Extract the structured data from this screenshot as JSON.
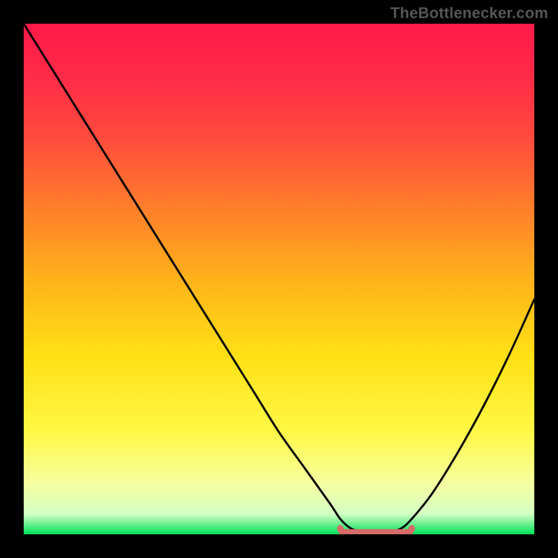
{
  "attribution": "TheBottlenecker.com",
  "chart_data": {
    "type": "line",
    "title": "",
    "xlabel": "",
    "ylabel": "",
    "xlim": [
      0,
      100
    ],
    "ylim": [
      0,
      100
    ],
    "x": [
      0,
      5,
      10,
      15,
      20,
      25,
      30,
      35,
      40,
      45,
      50,
      55,
      60,
      62,
      64,
      66,
      68,
      70,
      72,
      74,
      76,
      80,
      85,
      90,
      95,
      100
    ],
    "values": [
      100,
      92,
      84,
      76,
      68,
      60,
      52,
      44,
      36,
      28,
      20,
      13,
      6,
      3,
      1.2,
      0.5,
      0.2,
      0.2,
      0.5,
      1.2,
      3,
      8,
      16,
      25,
      35,
      46
    ],
    "trough": {
      "x_start": 62,
      "x_end": 76,
      "y": 0.4
    },
    "gradient_stops": [
      {
        "offset": 0.0,
        "color": "#ff1a4a"
      },
      {
        "offset": 0.1,
        "color": "#ff2a48"
      },
      {
        "offset": 0.22,
        "color": "#ff4a3e"
      },
      {
        "offset": 0.35,
        "color": "#ff7a2c"
      },
      {
        "offset": 0.5,
        "color": "#ffb21a"
      },
      {
        "offset": 0.65,
        "color": "#ffe015"
      },
      {
        "offset": 0.8,
        "color": "#fff846"
      },
      {
        "offset": 0.9,
        "color": "#f6ffa0"
      },
      {
        "offset": 0.96,
        "color": "#d4ffc4"
      },
      {
        "offset": 1.0,
        "color": "#00e25a"
      }
    ],
    "curve_stroke": "#000000",
    "trough_stroke": "#d86a6a"
  }
}
